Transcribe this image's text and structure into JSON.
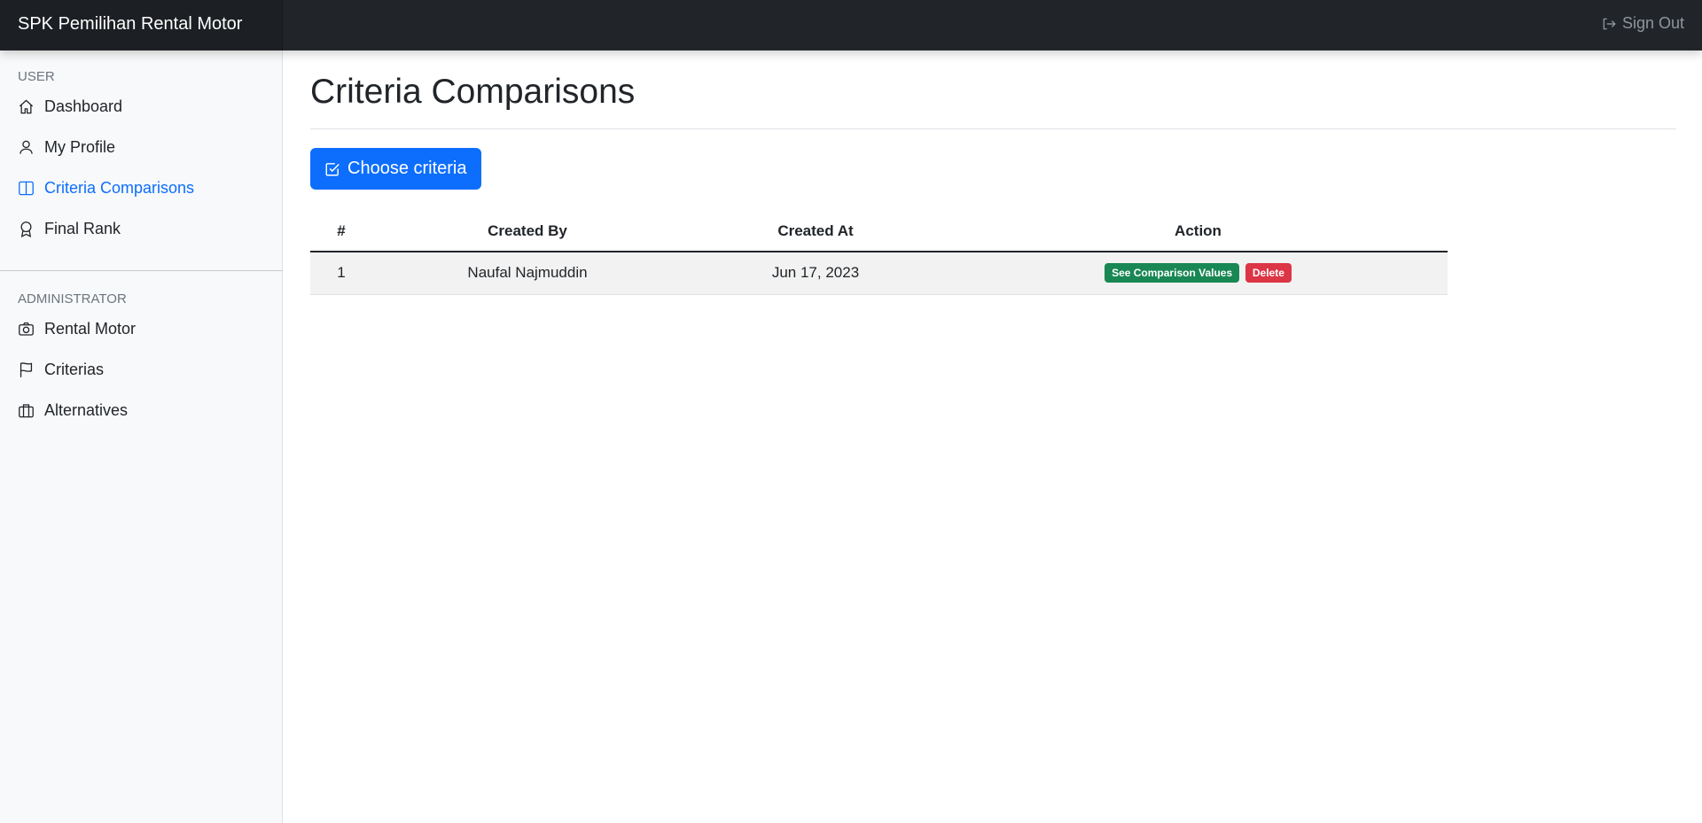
{
  "app": {
    "brand": "SPK Pemilihan Rental Motor",
    "signout_label": "Sign Out"
  },
  "sidebar": {
    "user_heading": "USER",
    "user_items": [
      {
        "label": "Dashboard",
        "icon": "house-icon"
      },
      {
        "label": "My Profile",
        "icon": "person-icon"
      },
      {
        "label": "Criteria Comparisons",
        "icon": "layout-split-icon",
        "active": true
      },
      {
        "label": "Final Rank",
        "icon": "award-icon"
      }
    ],
    "admin_heading": "ADMINISTRATOR",
    "admin_items": [
      {
        "label": "Rental Motor",
        "icon": "camera-icon"
      },
      {
        "label": "Criterias",
        "icon": "flag-icon"
      },
      {
        "label": "Alternatives",
        "icon": "briefcase-icon"
      }
    ]
  },
  "main": {
    "title": "Criteria Comparisons",
    "choose_button": "Choose criteria",
    "table": {
      "headers": [
        "#",
        "Created By",
        "Created At",
        "Action"
      ],
      "rows": [
        {
          "num": "1",
          "created_by": "Naufal Najmuddin",
          "created_at": "Jun 17, 2023",
          "actions": {
            "see": "See Comparison Values",
            "delete": "Delete"
          }
        }
      ]
    }
  },
  "colors": {
    "navbar": "#212529",
    "primary": "#0d6efd",
    "success": "#198754",
    "danger": "#dc3545"
  }
}
